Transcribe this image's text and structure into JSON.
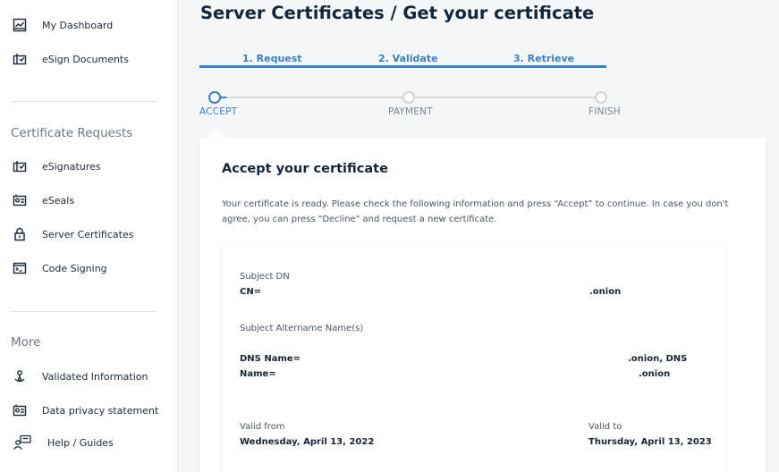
{
  "sidebar": {
    "items_top": [
      {
        "label": "My Dashboard",
        "icon": "dashboard-icon"
      },
      {
        "label": "eSign Documents",
        "icon": "esign-icon"
      }
    ],
    "section_requests": "Certificate Requests",
    "items_requests": [
      {
        "label": "eSignatures",
        "icon": "signature-icon"
      },
      {
        "label": "eSeals",
        "icon": "seal-icon"
      },
      {
        "label": "Server Certificates",
        "icon": "lock-icon"
      },
      {
        "label": "Code Signing",
        "icon": "code-icon"
      }
    ],
    "section_more": "More",
    "items_more": [
      {
        "label": "Validated Information",
        "icon": "validated-icon"
      },
      {
        "label": "Data privacy statement",
        "icon": "privacy-icon"
      },
      {
        "label": "Help / Guides",
        "icon": "help-icon"
      }
    ]
  },
  "page": {
    "title": "Server Certificates / Get your certificate",
    "tabs": [
      "1. Request",
      "2. Validate",
      "3. Retrieve"
    ],
    "progress": [
      "ACCEPT",
      "PAYMENT",
      "FINISH"
    ],
    "active_step": "ACCEPT"
  },
  "card": {
    "title": "Accept your certificate",
    "description": "Your certificate is ready. Please check the following information and press “Accept” to continue. In case you don't agree, you can press \"Decline\" and request a new certificate.",
    "subject_dn_label": "Subject DN",
    "subject_dn_prefix": "CN=",
    "subject_dn_suffix": ".onion",
    "alt_name_label": "Subject Altername Name(s)",
    "alt_name_line1_prefix": "DNS Name=",
    "alt_name_line1_suffix": ".onion, DNS",
    "alt_name_line2_prefix": "Name=",
    "alt_name_line2_suffix": ".onion",
    "valid_from_label": "Valid from",
    "valid_from_value": "Wednesday, April 13, 2022",
    "valid_to_label": "Valid to",
    "valid_to_value": "Thursday, April 13, 2023"
  },
  "colors": {
    "accent": "#3b7fc4",
    "heading": "#13263a",
    "muted": "#7b8794"
  }
}
